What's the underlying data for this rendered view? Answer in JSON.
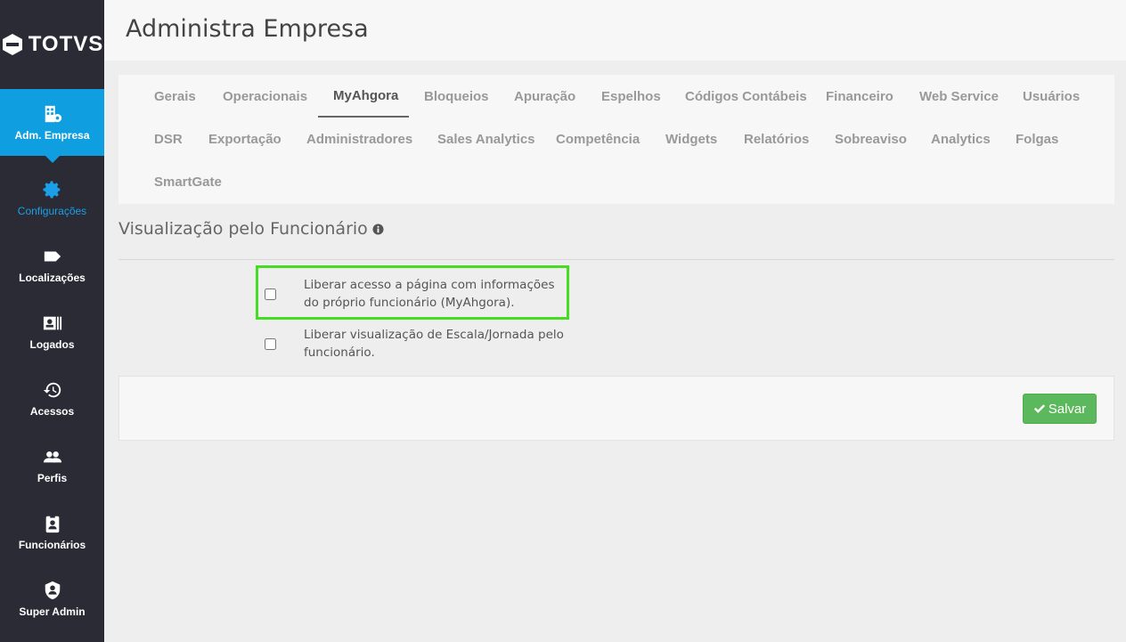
{
  "app": {
    "logo_text": "TOTVS",
    "page_title": "Administra Empresa"
  },
  "sidebar": {
    "items": [
      {
        "label": "Adm. Empresa",
        "icon": "building-gear-icon"
      },
      {
        "label": "Configurações",
        "icon": "gear-icon"
      },
      {
        "label": "Localizações",
        "icon": "tag-icon"
      },
      {
        "label": "Logados",
        "icon": "id-card-icon"
      },
      {
        "label": "Acessos",
        "icon": "history-icon"
      },
      {
        "label": "Perfis",
        "icon": "users-icon"
      },
      {
        "label": "Funcionários",
        "icon": "badge-icon"
      },
      {
        "label": "Super Admin",
        "icon": "user-shield-icon"
      }
    ]
  },
  "tabs": {
    "row1": [
      "Gerais",
      "Operacionais",
      "MyAhgora",
      "Bloqueios",
      "Apuração",
      "Espelhos",
      "Códigos Contábeis",
      "Financeiro",
      "Web Service",
      "Usuários"
    ],
    "row2": [
      "DSR",
      "Exportação",
      "Administradores",
      "Sales Analytics",
      "Competência",
      "Widgets",
      "Relatórios",
      "Sobreaviso",
      "Analytics",
      "Folgas"
    ],
    "row3": [
      "SmartGate"
    ],
    "active": "MyAhgora"
  },
  "section": {
    "title": "Visualização pelo Funcionário",
    "options": [
      {
        "label": "Liberar acesso a página com informações do próprio funcionário (MyAhgora).",
        "checked": false
      },
      {
        "label": "Liberar visualização de Escala/Jornada pelo funcionário.",
        "checked": false
      }
    ]
  },
  "footer": {
    "save_label": "Salvar"
  },
  "colors": {
    "sidebar_bg": "#2b2b36",
    "active_nav": "#0f9fe0",
    "highlight": "#44dd22",
    "save": "#5cb85c"
  }
}
